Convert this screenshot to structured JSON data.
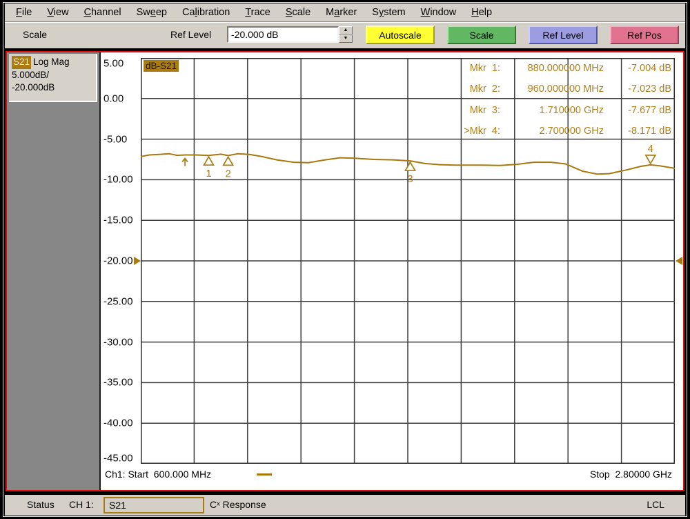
{
  "menu": {
    "items": [
      {
        "label": "File",
        "u": 0
      },
      {
        "label": "View",
        "u": 0
      },
      {
        "label": "Channel",
        "u": 0
      },
      {
        "label": "Sweep",
        "u": 2
      },
      {
        "label": "Calibration",
        "u": 2
      },
      {
        "label": "Trace",
        "u": 0
      },
      {
        "label": "Scale",
        "u": 0
      },
      {
        "label": "Marker",
        "u": 1
      },
      {
        "label": "System",
        "u": 1
      },
      {
        "label": "Window",
        "u": 0
      },
      {
        "label": "Help",
        "u": 0
      }
    ]
  },
  "toolbar": {
    "name_label": "Scale",
    "ref_level_label": "Ref Level",
    "ref_level_value": "-20.000 dB",
    "spinner_up": "▲",
    "spinner_down": "▼",
    "buttons": [
      {
        "id": "autoscale-button",
        "label": "Autoscale",
        "color": "#ffff33",
        "light": "#ffffa8",
        "dark": "#a3a300"
      },
      {
        "id": "scale-button",
        "label": "Scale",
        "color": "#62b862",
        "light": "#b2e2b2",
        "dark": "#2e7a2e"
      },
      {
        "id": "ref-level-button",
        "label": "Ref Level",
        "color": "#9c9ce2",
        "light": "#cecef4",
        "dark": "#5454a8"
      },
      {
        "id": "ref-pos-button",
        "label": "Ref Pos",
        "color": "#e0718f",
        "light": "#f2b0c4",
        "dark": "#9e3c5c"
      }
    ]
  },
  "sidebar": {
    "trace_label": "S21",
    "format": "Log Mag",
    "scale_per_div": "5.000dB/",
    "ref_level": "-20.000dB"
  },
  "chart_data": {
    "type": "line",
    "title": "dB-S21",
    "x_range_ghz": [
      0.6,
      2.8
    ],
    "ylim": [
      -45,
      5
    ],
    "ydiv_db": 5,
    "grid": {
      "x_divisions": 10,
      "y_divisions": 10,
      "grid_on": true
    },
    "y_ticks": [
      "5.00",
      "0.00",
      "-5.00",
      "-10.00",
      "-15.00",
      "-20.00",
      "-25.00",
      "-30.00",
      "-35.00",
      "-40.00",
      "-45.00"
    ],
    "ref_level_db": -20,
    "start_label": "Ch1: Start  600.000 MHz",
    "stop_label": "Stop  2.80000 GHz",
    "series": [
      {
        "name": "S21",
        "color": "#a8780e",
        "points": [
          [
            0.6,
            -7.15
          ],
          [
            0.635,
            -6.95
          ],
          [
            0.67,
            -6.9
          ],
          [
            0.717,
            -6.8
          ],
          [
            0.75,
            -7.0
          ],
          [
            0.782,
            -6.95
          ],
          [
            0.83,
            -6.95
          ],
          [
            0.88,
            -7.004
          ],
          [
            0.93,
            -6.85
          ],
          [
            0.96,
            -7.023
          ],
          [
            1.0,
            -6.8
          ],
          [
            1.05,
            -6.9
          ],
          [
            1.1,
            -7.15
          ],
          [
            1.16,
            -7.55
          ],
          [
            1.23,
            -7.85
          ],
          [
            1.29,
            -7.9
          ],
          [
            1.36,
            -7.55
          ],
          [
            1.42,
            -7.3
          ],
          [
            1.48,
            -7.35
          ],
          [
            1.56,
            -7.5
          ],
          [
            1.64,
            -7.55
          ],
          [
            1.71,
            -7.677
          ],
          [
            1.77,
            -8.0
          ],
          [
            1.83,
            -8.15
          ],
          [
            1.9,
            -8.2
          ],
          [
            2.0,
            -8.2
          ],
          [
            2.08,
            -8.25
          ],
          [
            2.15,
            -8.1
          ],
          [
            2.22,
            -7.85
          ],
          [
            2.29,
            -7.85
          ],
          [
            2.35,
            -8.05
          ],
          [
            2.42,
            -8.95
          ],
          [
            2.48,
            -9.3
          ],
          [
            2.53,
            -9.25
          ],
          [
            2.6,
            -8.8
          ],
          [
            2.66,
            -8.35
          ],
          [
            2.7,
            -8.171
          ],
          [
            2.74,
            -8.3
          ],
          [
            2.8,
            -8.6
          ]
        ]
      }
    ],
    "markers": [
      {
        "n": "1",
        "readout_label": "Mkr  1:",
        "freq_label": "880.000000 MHz",
        "value_label": "-7.004 dB",
        "f_ghz": 0.88,
        "db": -7.004,
        "dir": "up"
      },
      {
        "n": "2",
        "readout_label": "Mkr  2:",
        "freq_label": "960.000000 MHz",
        "value_label": "-7.023 dB",
        "f_ghz": 0.96,
        "db": -7.023,
        "dir": "up"
      },
      {
        "n": "3",
        "readout_label": "Mkr  3:",
        "freq_label": "1.710000 GHz",
        "value_label": "-7.677 dB",
        "f_ghz": 1.71,
        "db": -7.677,
        "dir": "up"
      },
      {
        "n": "4",
        "readout_label": ">Mkr  4:",
        "freq_label": "2.700000 GHz",
        "value_label": "-8.171 dB",
        "f_ghz": 2.7,
        "db": -8.171,
        "dir": "down"
      }
    ],
    "annotation_arrow": {
      "f_ghz": 0.782,
      "db": -6.95
    }
  },
  "statusbar": {
    "status": "Status",
    "channel": "CH 1:",
    "measurement": "S21",
    "cal_status": "Cˣ Response",
    "mode": "LCL"
  },
  "colors": {
    "accent_gold": "#a97b10",
    "trace": "#a8780e",
    "readout_text": "#b0801a",
    "frame_red": "#de0f0f",
    "chrome_gray": "#d4d0c8",
    "sidebar_gray": "#878787",
    "grid_line": "#3c3c3c"
  }
}
